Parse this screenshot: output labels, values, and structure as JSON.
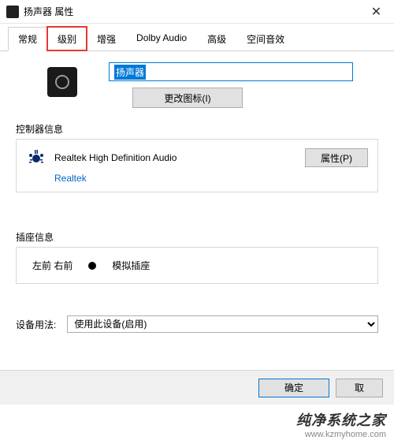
{
  "window": {
    "title": "扬声器 属性",
    "close_glyph": "✕"
  },
  "tabs": {
    "items": [
      {
        "label": "常规"
      },
      {
        "label": "级别"
      },
      {
        "label": "增强"
      },
      {
        "label": "Dolby Audio"
      },
      {
        "label": "高级"
      },
      {
        "label": "空间音效"
      }
    ]
  },
  "device": {
    "name_value": "扬声器",
    "change_icon_label": "更改图标(I)"
  },
  "controller": {
    "group_label": "控制器信息",
    "name": "Realtek High Definition Audio",
    "vendor": "Realtek",
    "properties_btn": "属性(P)"
  },
  "jack": {
    "group_label": "插座信息",
    "position": "左前 右前",
    "type": "模拟插座"
  },
  "usage": {
    "label": "设备用法:",
    "selected": "使用此设备(启用)"
  },
  "footer": {
    "ok": "确定",
    "cancel": "取"
  },
  "watermark": {
    "text": "纯净系统之家",
    "url": "www.kzmyhome.com"
  }
}
